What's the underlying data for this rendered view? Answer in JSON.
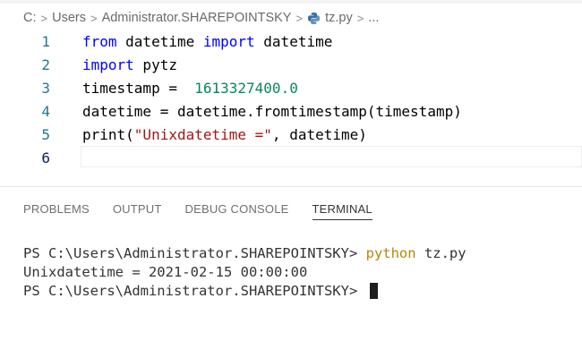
{
  "breadcrumb": {
    "parts": [
      "C:",
      "Users",
      "Administrator.SHAREPOINTSKY",
      "tz.py",
      "..."
    ],
    "file_icon": "python-file-icon"
  },
  "editor": {
    "lines": [
      {
        "num": "1",
        "tokens": [
          {
            "t": "from",
            "c": "kw"
          },
          {
            "t": " datetime ",
            "c": "plain"
          },
          {
            "t": "import",
            "c": "kw"
          },
          {
            "t": " datetime",
            "c": "plain"
          }
        ]
      },
      {
        "num": "2",
        "tokens": [
          {
            "t": "import",
            "c": "kw"
          },
          {
            "t": " pytz",
            "c": "plain"
          }
        ]
      },
      {
        "num": "3",
        "tokens": [
          {
            "t": "timestamp =  ",
            "c": "plain"
          },
          {
            "t": "1613327400.0",
            "c": "num"
          }
        ]
      },
      {
        "num": "4",
        "tokens": [
          {
            "t": "datetime = datetime.fromtimestamp(timestamp)",
            "c": "plain"
          }
        ]
      },
      {
        "num": "5",
        "tokens": [
          {
            "t": "print(",
            "c": "plain"
          },
          {
            "t": "\"Unixdatetime =\"",
            "c": "str"
          },
          {
            "t": ", datetime)",
            "c": "plain"
          }
        ]
      },
      {
        "num": "6",
        "tokens": []
      }
    ]
  },
  "panel": {
    "tabs": [
      "PROBLEMS",
      "OUTPUT",
      "DEBUG CONSOLE",
      "TERMINAL"
    ],
    "active_tab": "TERMINAL"
  },
  "terminal": {
    "prompt1": "PS C:\\Users\\Administrator.SHAREPOINTSKY> ",
    "command": "python",
    "args": " tz.py",
    "output": "Unixdatetime = 2021-02-15 00:00:00",
    "prompt2": "PS C:\\Users\\Administrator.SHAREPOINTSKY> "
  }
}
